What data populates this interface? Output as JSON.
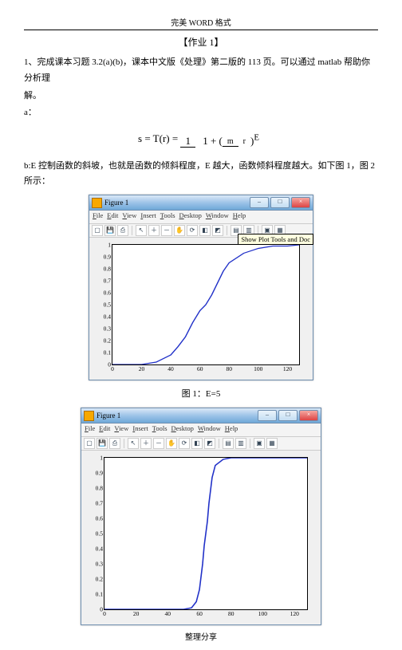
{
  "header": {
    "top": "完美 WORD 格式"
  },
  "title": "【作业 1】",
  "q1": {
    "line1": "1、完成课本习题 3.2(a)(b)，课本中文版《处理》第二版的 113 页。可以通过 matlab 帮助你分析理",
    "line2": "解。",
    "a_label": "a：",
    "formula_lhs": "s = T(r) =",
    "formula_num": "1",
    "formula_den_left": "1 + (",
    "formula_den_frac_num": "m",
    "formula_den_frac_den": "r",
    "formula_den_right_exp": ")",
    "formula_exp": "E",
    "b_line": "b:E 控制函数的斜坡，也就是函数的倾斜程度，E 越大，函数倾斜程度越大。如下图 1，图 2 所示："
  },
  "fig_window": {
    "title": "Figure 1",
    "menu": [
      "File",
      "Edit",
      "View",
      "Insert",
      "Tools",
      "Desktop",
      "Window",
      "Help"
    ],
    "tooltip": "Show Plot Tools and Doc",
    "yticks": [
      "0",
      "0.1",
      "0.2",
      "0.3",
      "0.4",
      "0.5",
      "0.6",
      "0.7",
      "0.8",
      "0.9",
      "1"
    ],
    "xticks": [
      "0",
      "20",
      "40",
      "60",
      "80",
      "100",
      "120"
    ]
  },
  "captions": {
    "fig1": "图 1：E=5"
  },
  "footer": "整理分享",
  "chart_data": [
    {
      "type": "line",
      "title": "Figure 1 (E=5)",
      "xlabel": "",
      "ylabel": "",
      "xlim": [
        0,
        128
      ],
      "ylim": [
        0,
        1
      ],
      "series": [
        {
          "name": "s = 1/(1+(m/r)^E), m≈64, E=5",
          "x": [
            0,
            10,
            20,
            30,
            40,
            45,
            50,
            55,
            60,
            64,
            68,
            72,
            76,
            80,
            90,
            100,
            110,
            120,
            128
          ],
          "y": [
            0.0,
            0.0,
            0.0,
            0.02,
            0.08,
            0.15,
            0.23,
            0.35,
            0.45,
            0.5,
            0.58,
            0.68,
            0.78,
            0.85,
            0.93,
            0.97,
            0.99,
            0.99,
            1.0
          ]
        }
      ]
    },
    {
      "type": "line",
      "title": "Figure 1 (larger E)",
      "xlabel": "",
      "ylabel": "",
      "xlim": [
        0,
        128
      ],
      "ylim": [
        0,
        1
      ],
      "series": [
        {
          "name": "s = 1/(1+(m/r)^E), m≈64, E large (~20)",
          "x": [
            0,
            40,
            50,
            55,
            58,
            60,
            62,
            63,
            64,
            65,
            66,
            68,
            70,
            75,
            80,
            90,
            100,
            120,
            128
          ],
          "y": [
            0.0,
            0.0,
            0.0,
            0.01,
            0.05,
            0.13,
            0.3,
            0.42,
            0.5,
            0.58,
            0.7,
            0.87,
            0.95,
            0.99,
            1.0,
            1.0,
            1.0,
            1.0,
            1.0
          ]
        }
      ]
    }
  ]
}
